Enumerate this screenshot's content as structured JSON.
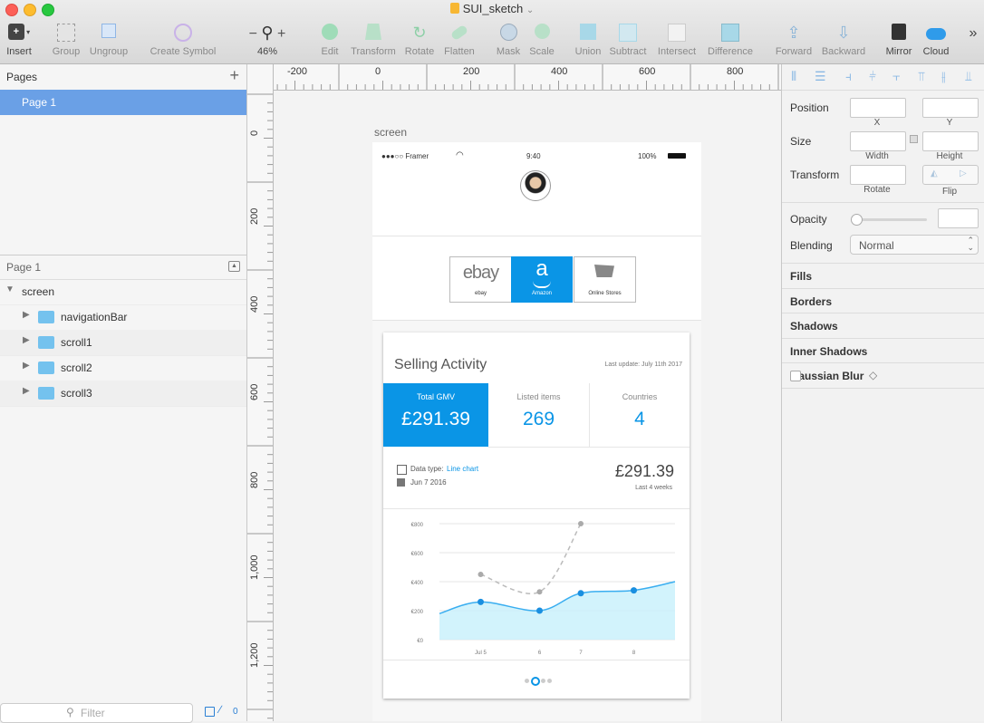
{
  "window": {
    "title": "SUI_sketch"
  },
  "toolbar": {
    "insert": "Insert",
    "group": "Group",
    "ungroup": "Ungroup",
    "create_symbol": "Create Symbol",
    "zoom": "46%",
    "zoom_minus": "−",
    "zoom_plus": "+",
    "edit": "Edit",
    "transform": "Transform",
    "rotate": "Rotate",
    "flatten": "Flatten",
    "mask": "Mask",
    "scale": "Scale",
    "union": "Union",
    "subtract": "Subtract",
    "intersect": "Intersect",
    "difference": "Difference",
    "forward": "Forward",
    "backward": "Backward",
    "mirror": "Mirror",
    "cloud": "Cloud",
    "more": "»"
  },
  "pages": {
    "header": "Pages",
    "add": "+",
    "items": [
      "Page 1"
    ]
  },
  "layers": {
    "header": "Page 1",
    "root": "screen",
    "children": [
      "navigationBar",
      "scroll1",
      "scroll2",
      "scroll3"
    ]
  },
  "filter": {
    "placeholder": "Filter",
    "count": "0"
  },
  "ruler": {
    "h_ticks": [
      "-200",
      "0",
      "200",
      "400",
      "600",
      "800"
    ],
    "v_ticks": [
      "0",
      "200",
      "400",
      "600",
      "800",
      "1,000",
      "1,200"
    ]
  },
  "inspector": {
    "position": "Position",
    "x": "X",
    "y": "Y",
    "size": "Size",
    "width": "Width",
    "height": "Height",
    "transform": "Transform",
    "rotate": "Rotate",
    "flip": "Flip",
    "opacity": "Opacity",
    "opacity_level": 0,
    "blending": "Blending",
    "blending_value": "Normal",
    "sections": [
      "Fills",
      "Borders",
      "Shadows",
      "Inner Shadows",
      "Gaussian Blur"
    ]
  },
  "artboard": {
    "label": "screen",
    "status": {
      "carrier": "●●●○○ Framer",
      "time": "9:40",
      "battery": "100%"
    },
    "tabs": [
      {
        "logo": "ebay",
        "label": "ebay"
      },
      {
        "logo": "a",
        "label": "Amazon"
      },
      {
        "logo": "",
        "label": "Online Stores"
      }
    ],
    "card": {
      "title": "Selling Activity",
      "last_update": "Last update: July 11th 2017",
      "stats": [
        {
          "label": "Total GMV",
          "value": "£291.39"
        },
        {
          "label": "Listed items",
          "value": "269"
        },
        {
          "label": "Countries",
          "value": "4"
        }
      ],
      "data_type_label": "Data type:",
      "data_type_value": "Line chart",
      "date": "Jun 7 2016",
      "amount": "£291.39",
      "amount_caption": "Last 4 weeks"
    }
  },
  "colors": {
    "accent": "#0a95e6",
    "selection": "#6aa0e6",
    "series_fill": "#c7f0fb",
    "series_line": "#3aaef0"
  },
  "chart_data": {
    "type": "line",
    "y_ticks": [
      "€800",
      "€600",
      "€400",
      "€200",
      "€0"
    ],
    "x_ticks": [
      "Jul 5",
      "6",
      "7",
      "8"
    ],
    "ylim": [
      0,
      800
    ],
    "series": [
      {
        "style": "solid",
        "x": [
          0,
          0.7,
          1.7,
          2.4,
          3.3,
          4.0
        ],
        "y": [
          180,
          260,
          200,
          320,
          340,
          400
        ]
      },
      {
        "style": "dashed",
        "x": [
          0.7,
          1.7,
          2.4
        ],
        "y": [
          450,
          330,
          800
        ]
      }
    ]
  }
}
